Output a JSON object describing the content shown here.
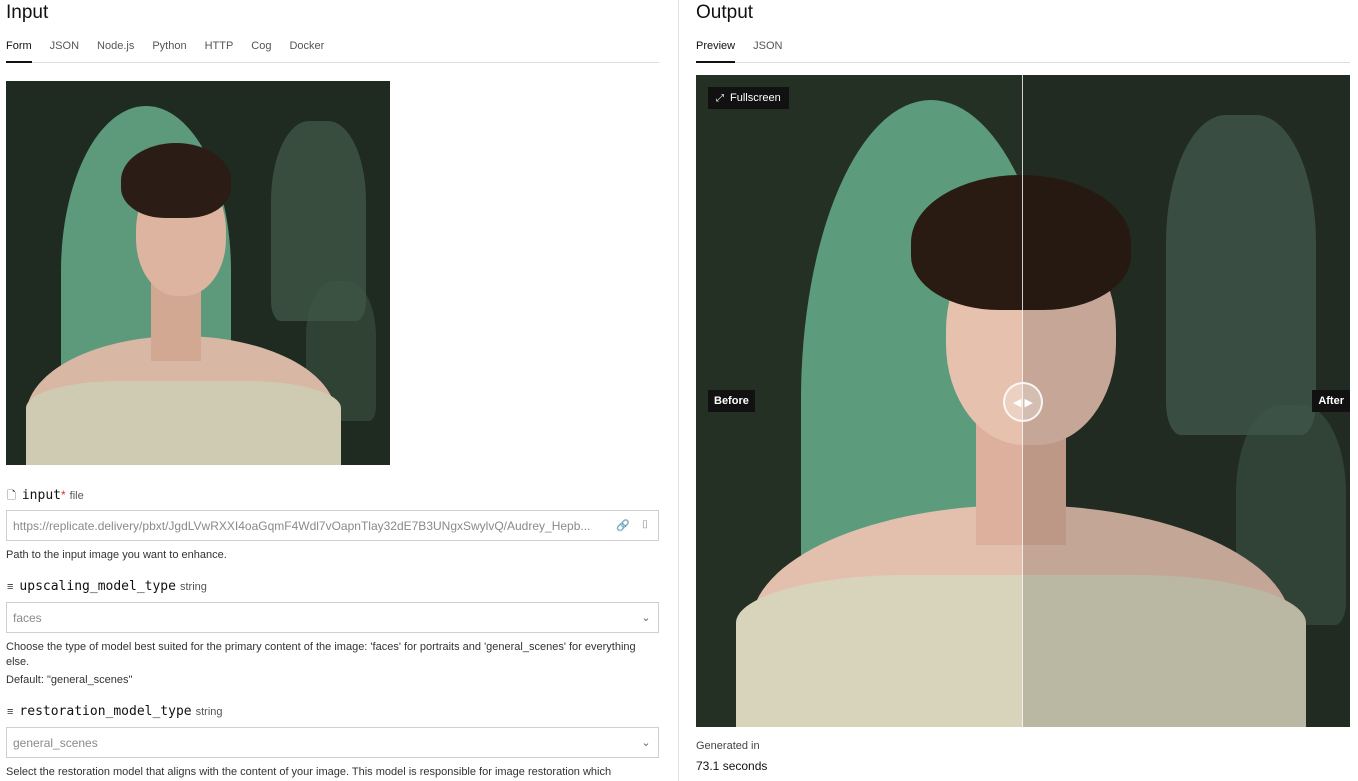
{
  "input": {
    "title": "Input",
    "tabs": [
      "Form",
      "JSON",
      "Node.js",
      "Python",
      "HTTP",
      "Cog",
      "Docker"
    ],
    "fields": [
      {
        "icon": "file-icon",
        "name": "input",
        "required_mark": "*",
        "type": "file",
        "value": "https://replicate.delivery/pbxt/JgdLVwRXXI4oaGqmF4Wdl7vOapnTlay32dE7B3UNgxSwylvQ/Audrey_Hepb...",
        "help": "Path to the input image you want to enhance."
      },
      {
        "icon": "list-icon",
        "name": "upscaling_model_type",
        "type": "string",
        "value": "faces",
        "help": "Choose the type of model best suited for the primary content of the image: 'faces' for portraits and 'general_scenes' for everything else.",
        "default": "Default: \"general_scenes\""
      },
      {
        "icon": "list-icon",
        "name": "restoration_model_type",
        "type": "string",
        "value": "general_scenes",
        "help": "Select the restoration model that aligns with the content of your image. This model is responsible for image restoration which"
      }
    ]
  },
  "output": {
    "title": "Output",
    "tabs": [
      "Preview",
      "JSON"
    ],
    "fullscreen_label": "Fullscreen",
    "before_label": "Before",
    "after_label": "After",
    "generated_label": "Generated in",
    "generated_value": "73.1 seconds"
  },
  "icons": {
    "file": "🗋",
    "list": "≡",
    "link": "🔗",
    "camera": "⌷",
    "chevron": "⌄",
    "fullscreen": "⤢",
    "slider": "◀ ▶"
  },
  "colors": {
    "required": "#e0312b",
    "tab_active": "#111111"
  }
}
